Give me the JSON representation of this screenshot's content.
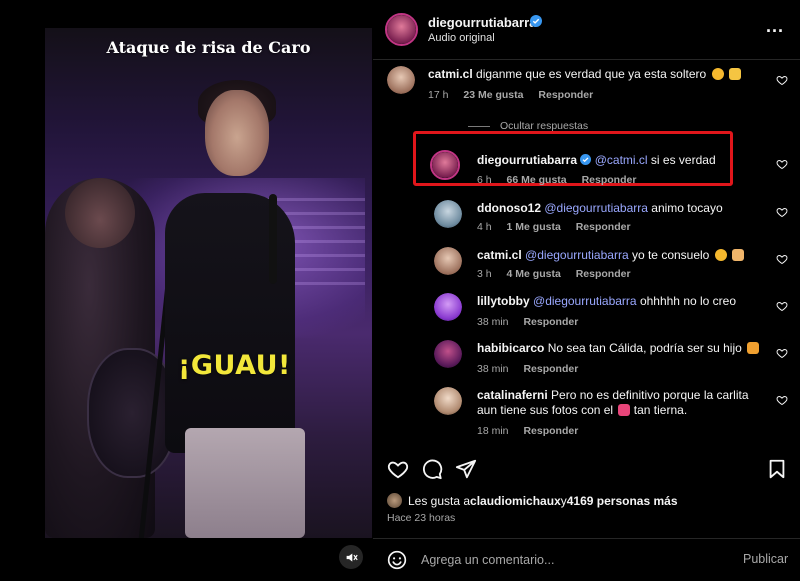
{
  "video": {
    "title": "Ataque de risa de Caro",
    "caption": "¡GUAU!"
  },
  "header": {
    "username": "diegourrutiabarra",
    "subtitle": "Audio original",
    "more": "..."
  },
  "comments": [
    {
      "user": "catmi.cl",
      "mention": "",
      "text": "diganme que es verdad que ya esta soltero",
      "time": "17 h",
      "likes": "23 Me gusta",
      "reply": "Responder",
      "avatar_color": "#c9a48f"
    }
  ],
  "hide_replies": "Ocultar respuestas",
  "replies": [
    {
      "user": "diegourrutiabarra",
      "verified": true,
      "mention": "@catmi.cl",
      "text": "si es verdad",
      "time": "6 h",
      "likes": "66 Me gusta",
      "reply": "Responder",
      "avatar_color": "#8a3a6a"
    },
    {
      "user": "ddonoso12",
      "mention": "@diegourrutiabarra",
      "text": "animo tocayo",
      "time": "4 h",
      "likes": "1 Me gusta",
      "reply": "Responder",
      "avatar_color": "#7fa0b8"
    },
    {
      "user": "catmi.cl",
      "mention": "@diegourrutiabarra",
      "text": "yo te consuelo",
      "time": "3 h",
      "likes": "4 Me gusta",
      "reply": "Responder",
      "avatar_color": "#c9a48f"
    },
    {
      "user": "lillytobby",
      "mention": "@diegourrutiabarra",
      "text": "ohhhhh no lo creo",
      "time": "38 min",
      "likes": "",
      "reply": "Responder",
      "avatar_color": "#9d4fd8"
    },
    {
      "user": "habibicarco",
      "mention": "",
      "text": "No sea tan Cálida, podría ser su hijo",
      "time": "38 min",
      "likes": "",
      "reply": "Responder",
      "avatar_color": "#6a2a7a"
    },
    {
      "user": "catalinaferni",
      "mention": "",
      "text": "Pero no es definitivo porque la carlita",
      "text2": "aun tiene sus fotos con el",
      "text3": "tan tierna.",
      "time": "18 min",
      "likes": "",
      "reply": "Responder",
      "avatar_color": "#d8b79d"
    }
  ],
  "likes_line": {
    "prefix": "Les gusta a ",
    "user": "claudiomichaux",
    "middle": " y ",
    "count": "4169 personas más"
  },
  "posted": "Hace 23 horas",
  "composer": {
    "placeholder": "Agrega un comentario...",
    "publish": "Publicar"
  },
  "colors": {
    "background": "#000000",
    "muted": "#a8a8a8",
    "mention": "#9aa8ff",
    "verified": "#3897f0",
    "highlight": "#e0161b",
    "caption_yellow": "#f2e73a"
  }
}
